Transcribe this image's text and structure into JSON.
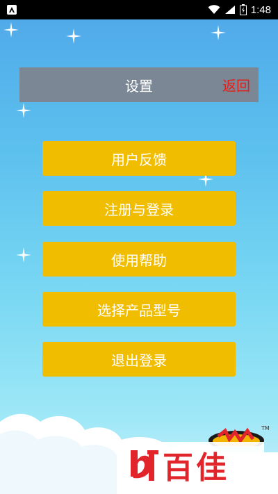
{
  "status_bar": {
    "time": "1:48",
    "icons": [
      "notification-icon",
      "wifi-icon",
      "signal-icon",
      "battery-icon"
    ]
  },
  "header": {
    "title": "设置",
    "back_label": "返回"
  },
  "menu": {
    "items": [
      {
        "label": "用户反馈"
      },
      {
        "label": "注册与登录"
      },
      {
        "label": "使用帮助"
      },
      {
        "label": "选择产品型号"
      },
      {
        "label": "退出登录"
      }
    ]
  },
  "watermark": {
    "text": "百佳",
    "tm": "TM"
  },
  "colors": {
    "header_bg": "#7b8794",
    "back_text": "#e0201b",
    "button_bg": "#f1bd00",
    "watermark_text": "#e2242b"
  }
}
